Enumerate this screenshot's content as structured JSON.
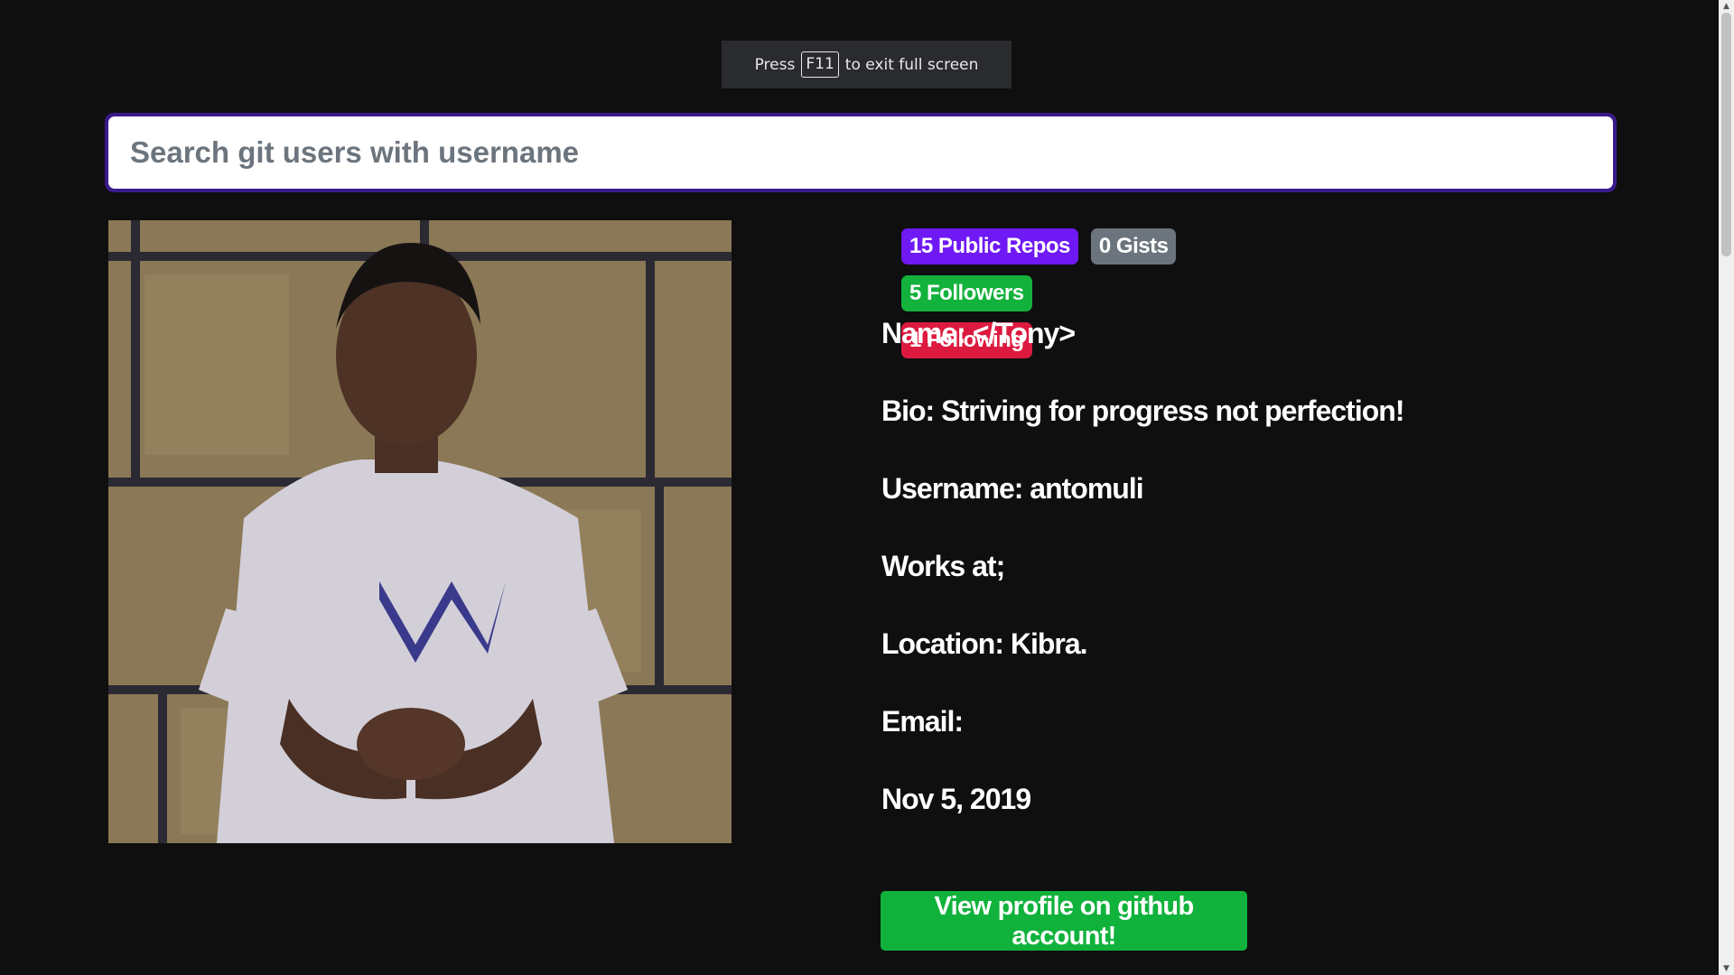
{
  "fullscreen_toast": {
    "before": "Press",
    "key": "F11",
    "after": "to exit full screen"
  },
  "search": {
    "placeholder": "Search git users with username",
    "value": ""
  },
  "badges": [
    {
      "label": "15 Public Repos",
      "color": "#6f19f5"
    },
    {
      "label": "0 Gists",
      "color": "#6c757d"
    },
    {
      "label": "5 Followers",
      "color": "#13b23c"
    },
    {
      "label": "1 Following",
      "color": "#dc1a3f"
    }
  ],
  "profile": {
    "name": "Name: </Tony>",
    "bio": "Bio: Striving for progress not perfection!",
    "username": "Username: antomuli",
    "company": "Works at;",
    "location": "Location: Kibra.",
    "email": "Email:",
    "joined": "Nov 5, 2019",
    "button_label": "View profile on github account!"
  },
  "colors": {
    "background": "#0f0f10",
    "button": "#11b23c",
    "search_border": "#3a1a8a"
  }
}
